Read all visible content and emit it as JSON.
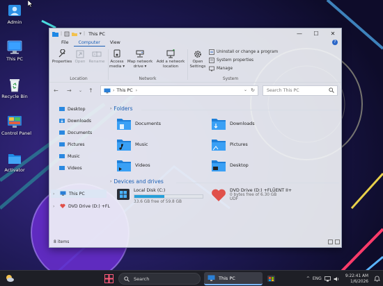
{
  "desktop": {
    "icons": [
      {
        "label": "Admin",
        "icon": "user-folder-icon"
      },
      {
        "label": "This PC",
        "icon": "monitor-icon"
      },
      {
        "label": "Recycle Bin",
        "icon": "recycle-bin-icon"
      },
      {
        "label": "Control Panel",
        "icon": "control-panel-icon"
      },
      {
        "label": "Activator",
        "icon": "folder-icon"
      }
    ]
  },
  "window": {
    "title": "This PC",
    "controls": {
      "minimize": "—",
      "maximize": "☐",
      "close": "✕"
    },
    "menu_tabs": [
      "File",
      "Computer",
      "View"
    ],
    "active_tab": "Computer",
    "help_glyph": "?",
    "ribbon": {
      "location": {
        "label": "Location",
        "buttons": [
          "Properties",
          "Open",
          "Rename"
        ]
      },
      "network": {
        "label": "Network",
        "buttons": [
          "Access media ▾",
          "Map network drive ▾",
          "Add a network location"
        ]
      },
      "system": {
        "label": "System",
        "open_settings": "Open Settings",
        "items": [
          "Uninstall or change a program",
          "System properties",
          "Manage"
        ]
      }
    },
    "address": {
      "path": "This PC",
      "separator": "›",
      "search_placeholder": "Search This PC"
    },
    "nav_pane": {
      "quick_access": [
        "Desktop",
        "Downloads",
        "Documents",
        "Pictures",
        "Music",
        "Videos"
      ],
      "this_pc": "This PC",
      "dvd": "DVD Drive (D:) +FL"
    },
    "folders_section": {
      "heading": "Folders",
      "items": [
        "Documents",
        "Downloads",
        "Music",
        "Pictures",
        "Videos",
        "Desktop"
      ]
    },
    "drives_section": {
      "heading": "Devices and drives",
      "local_disk": {
        "name": "Local Disk (C:)",
        "free_text": "33.6 GB free of 59.8 GB",
        "used_fraction": 0.44
      },
      "dvd_drive": {
        "name": "DVD Drive (D:) +FLŪENT II+",
        "free_text": "0 bytes free of 6.30 GB",
        "fs": "UDF"
      }
    },
    "status": {
      "items_count": "8 items"
    }
  },
  "taskbar": {
    "search_label": "Search",
    "active_app": "This PC",
    "time": "9:22:41 AM",
    "date": "1/6/2026",
    "language": "ENG"
  },
  "colors": {
    "accent": "#1a5fb4",
    "folder_blue": "#1e88e5",
    "taskbar": "#1e1f26",
    "drive_bar": "#26a0da",
    "dvd_heart": "#e0504a"
  }
}
